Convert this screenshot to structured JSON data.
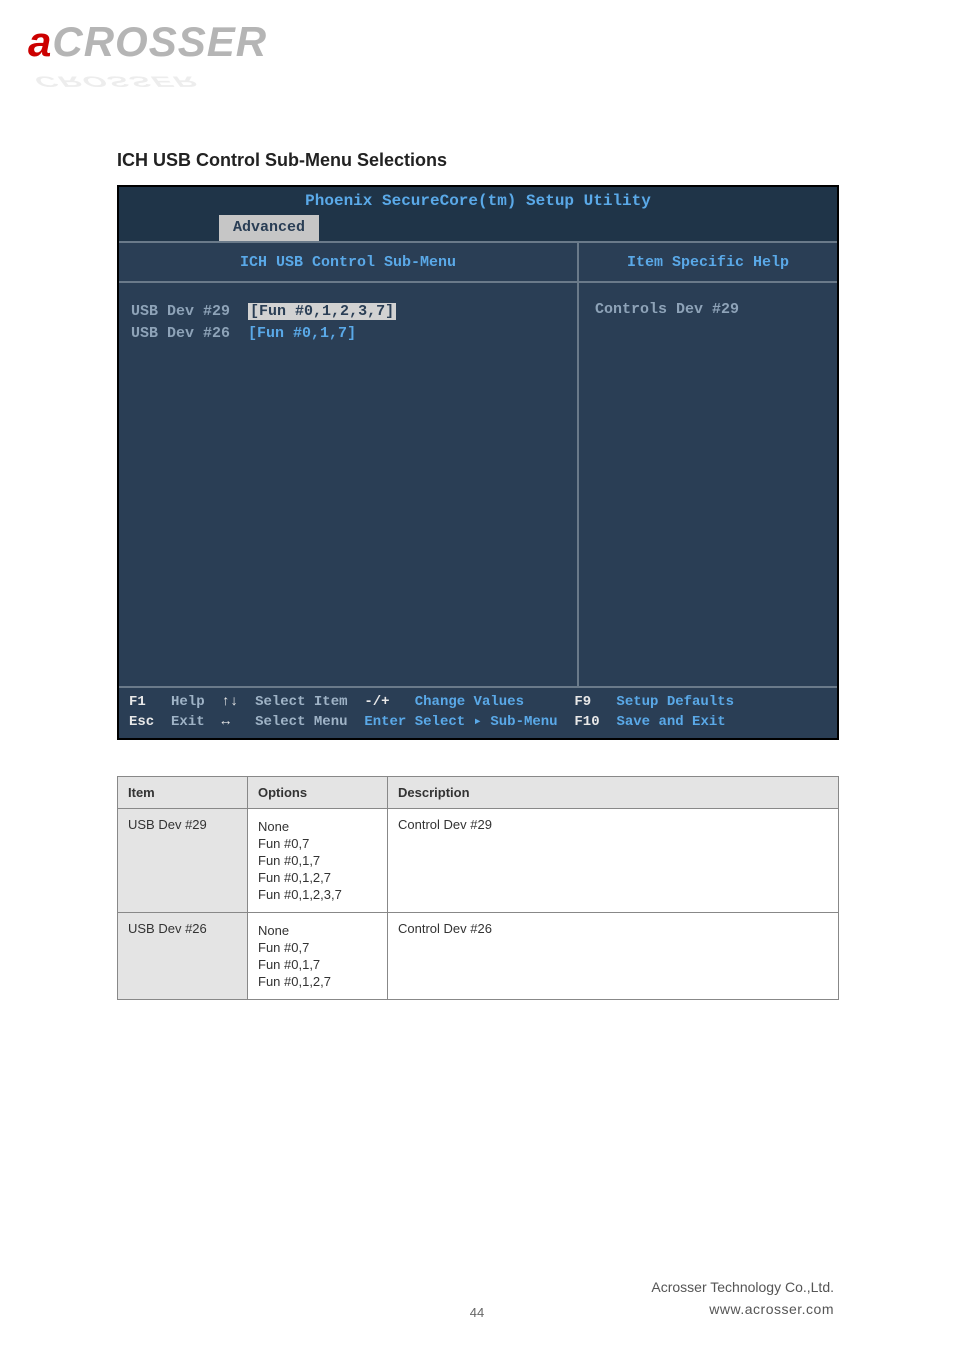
{
  "logo": {
    "a": "a",
    "rest": "CROSSER"
  },
  "section_title": "ICH USB Control Sub-Menu Selections",
  "bios": {
    "title": "Phoenix SecureCore(tm) Setup Utility",
    "tab": "Advanced",
    "left_header": "ICH USB Control Sub-Menu",
    "rows": [
      {
        "label": "USB Dev #29",
        "value": "[Fun #0,1,2,3,7]",
        "selected": true
      },
      {
        "label": "USB Dev #26",
        "value": "[Fun #0,1,7]",
        "selected": false
      }
    ],
    "right_header": "Item Specific Help",
    "right_text": "Controls Dev #29",
    "footer": {
      "line1_k1": "F1",
      "line1_d1": "Help",
      "line1_a1": "↑↓",
      "line1_d2": "Select Item",
      "line1_k2": "-/+",
      "line1_d3": "Change Values",
      "line1_k3": "F9",
      "line1_d4": "Setup Defaults",
      "line2_k1": "Esc",
      "line2_d1": "Exit",
      "line2_a1": "↔",
      "line2_d2": "Select Menu",
      "line2_k2": "Enter",
      "line2_d3": "Select ▸ Sub-Menu",
      "line2_k3": "F10",
      "line2_d4": "Save and Exit"
    }
  },
  "table": {
    "headers": {
      "item": "Item",
      "options": "Options",
      "description": "Description"
    },
    "rows": [
      {
        "item": "USB Dev #29",
        "options": [
          "None",
          "Fun #0,7",
          "Fun #0,1,7",
          "Fun #0,1,2,7",
          "Fun #0,1,2,3,7"
        ],
        "description": "Control Dev #29"
      },
      {
        "item": "USB Dev #26",
        "options": [
          "None",
          "Fun #0,7",
          "Fun #0,1,7",
          "Fun #0,1,2,7"
        ],
        "description": "Control Dev #26"
      }
    ]
  },
  "footer_company": "Acrosser Technology Co.,Ltd.",
  "footer_site": "www.acrosser.com",
  "page_number": "44"
}
